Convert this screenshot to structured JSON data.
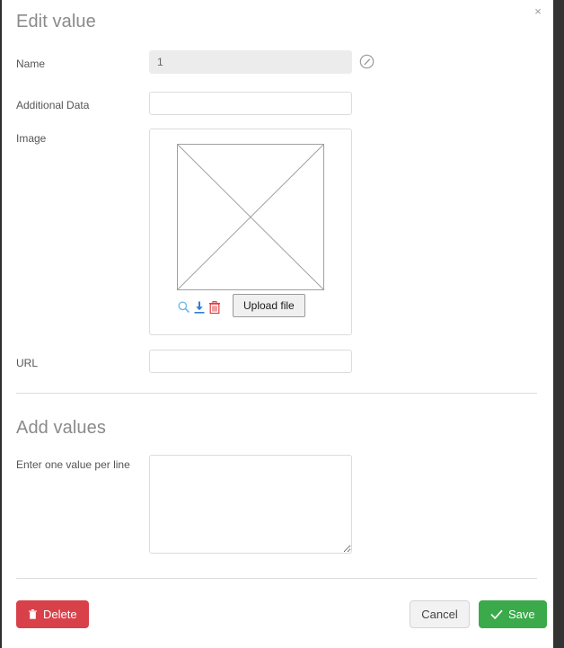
{
  "window": {
    "close_label": "×"
  },
  "edit_section": {
    "title": "Edit value",
    "fields": {
      "name": {
        "label": "Name",
        "value": "1",
        "placeholder": "",
        "disabled": true,
        "action_icon": "pencil-circle-icon"
      },
      "additional_data": {
        "label": "Additional Data",
        "value": "",
        "placeholder": ""
      },
      "image": {
        "label": "Image",
        "placeholder_icon": "image-placeholder-crossed-box",
        "tools": [
          {
            "name": "zoom-icon",
            "title": "Zoom"
          },
          {
            "name": "download-icon",
            "title": "Download"
          },
          {
            "name": "delete-icon",
            "title": "Delete"
          }
        ],
        "upload_label": "Upload file"
      },
      "url": {
        "label": "URL",
        "value": "",
        "placeholder": ""
      }
    }
  },
  "add_section": {
    "title": "Add values",
    "textarea": {
      "label": "Enter one value per line",
      "value": "",
      "placeholder": ""
    }
  },
  "footer": {
    "delete_label": "Delete",
    "cancel_label": "Cancel",
    "save_label": "Save"
  },
  "colors": {
    "danger": "#d9414a",
    "success": "#3aaa4a",
    "neutral": "#f2f2f2",
    "heading": "#8a8a8a",
    "label": "#555555",
    "border": "#dcdcdc",
    "disabled_bg": "#ececec",
    "frame_dark": "#333333",
    "tool_blue": "#3c91e6",
    "tool_red": "#e03c3c"
  }
}
